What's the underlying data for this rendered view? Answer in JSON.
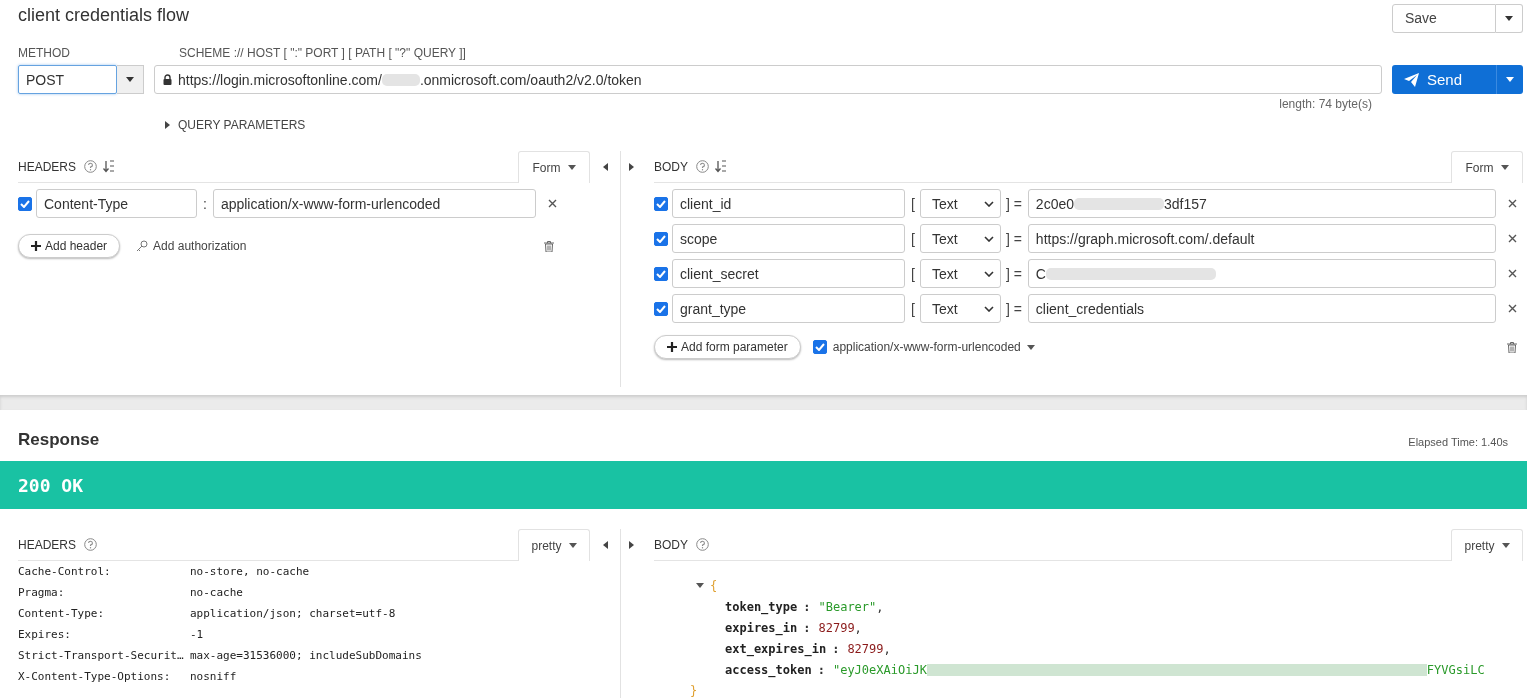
{
  "title": "client credentials flow",
  "save": {
    "label": "Save"
  },
  "method": {
    "label": "METHOD",
    "value": "POST"
  },
  "url": {
    "label": "SCHEME :// HOST [ \":\" PORT ] [ PATH [ \"?\" QUERY ]]",
    "before": "https://login.microsoftonline.com/",
    "redacted": true,
    "after": ".onmicrosoft.com/oauth2/v2.0/token",
    "length": "length: 74 byte(s)"
  },
  "send": {
    "label": "Send"
  },
  "query_parameters": {
    "label": "QUERY PARAMETERS",
    "expanded": false
  },
  "request_headers": {
    "title": "HEADERS",
    "mode": "Form",
    "add_button": "Add header",
    "auth_link": "Add authorization",
    "rows": [
      {
        "checked": true,
        "name": "Content-Type",
        "sep": ":",
        "value": "application/x-www-form-urlencoded",
        "redacted": false
      }
    ]
  },
  "request_body": {
    "title": "BODY",
    "mode": "Form",
    "add_button": "Add form parameter",
    "encoding": {
      "checked": true,
      "label": "application/x-www-form-urlencoded"
    },
    "rows": [
      {
        "checked": true,
        "name": "client_id",
        "open": "[",
        "type": "Text",
        "close": "] =",
        "value": "2c0e0",
        "redacted": true,
        "value_end": "3df157"
      },
      {
        "checked": true,
        "name": "scope",
        "open": "[",
        "type": "Text",
        "close": "] =",
        "value": "https://graph.microsoft.com/.default",
        "redacted": false
      },
      {
        "checked": true,
        "name": "client_secret",
        "open": "[",
        "type": "Text",
        "close": "] =",
        "value": "C",
        "redacted": true
      },
      {
        "checked": true,
        "name": "grant_type",
        "open": "[",
        "type": "Text",
        "close": "] =",
        "value": "client_credentials",
        "redacted": false
      }
    ]
  },
  "response": {
    "title": "Response",
    "elapsed": "Elapsed Time: 1.40s",
    "status": "200 OK",
    "headers": {
      "title": "HEADERS",
      "mode": "pretty",
      "rows": [
        {
          "name": "Cache-Control:",
          "value": "no-store, no-cache"
        },
        {
          "name": "Pragma:",
          "value": "no-cache"
        },
        {
          "name": "Content-Type:",
          "value": "application/json; charset=utf-8"
        },
        {
          "name": "Expires:",
          "value": "-1"
        },
        {
          "name": "Strict-Transport-Securit…",
          "value": "max-age=31536000; includeSubDomains"
        },
        {
          "name": "X-Content-Type-Options:",
          "value": "nosniff"
        }
      ]
    },
    "body": {
      "title": "BODY",
      "mode": "pretty",
      "expanded": true,
      "open": "{",
      "close": "}",
      "lines": [
        {
          "key": "token_type",
          "sep": ":",
          "kind": "string",
          "value": "\"Bearer\"",
          "suffix": ",",
          "redacted": false
        },
        {
          "key": "expires_in",
          "sep": ":",
          "kind": "number",
          "value": "82799",
          "suffix": ",",
          "redacted": false
        },
        {
          "key": "ext_expires_in",
          "sep": ":",
          "kind": "number",
          "value": "82799",
          "suffix": ",",
          "redacted": false
        },
        {
          "key": "access_token",
          "sep": ":",
          "kind": "string",
          "value": "\"eyJ0eXAiOiJK",
          "redacted": true,
          "value_end": "FYVGsiLC"
        }
      ]
    }
  }
}
